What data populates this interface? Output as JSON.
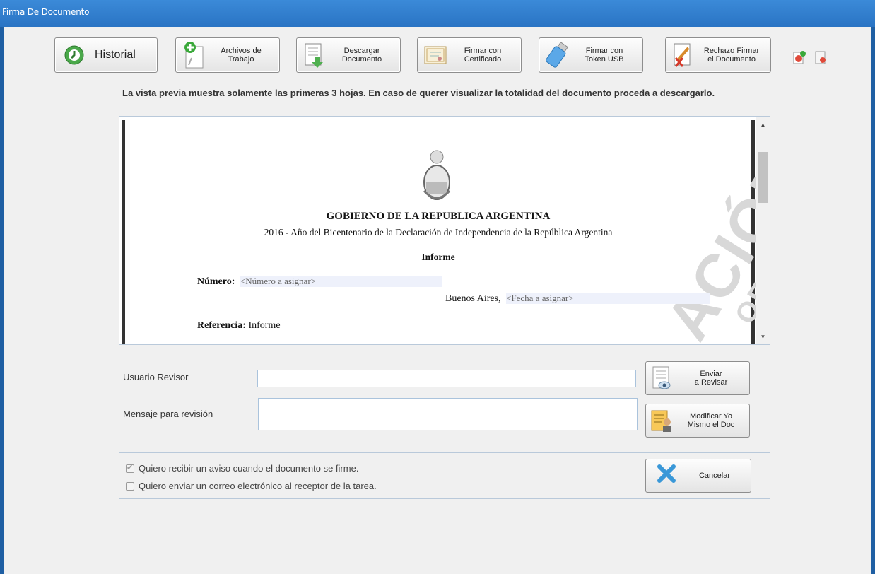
{
  "window": {
    "title": "Firma De Documento"
  },
  "toolbar": {
    "historial": "Historial",
    "archivos": "Archivos de\nTrabajo",
    "descargar": "Descargar\nDocumento",
    "firmar_cert": "Firmar con\nCertificado",
    "firmar_token": "Firmar con\nToken USB",
    "rechazo": "Rechazo Firmar\nel Documento"
  },
  "notice": "La vista previa muestra solamente las primeras 3 hojas. En caso de querer visualizar la totalidad del documento proceda a descargarlo.",
  "document": {
    "heading": "GOBIERNO DE LA REPUBLICA ARGENTINA",
    "year_line": "2016 - Año del Bicentenario de la Declaración de Independencia de la República Argentina",
    "type": "Informe",
    "numero_label": "Número:",
    "numero_value": "<Número a asignar>",
    "city": "Buenos Aires,",
    "fecha_value": "<Fecha a asignar>",
    "referencia_label": "Referencia:",
    "referencia_value": "Informe",
    "watermark_1": "ACIÓN",
    "watermark_2": "OFICIAL"
  },
  "review": {
    "usuario_label": "Usuario Revisor",
    "usuario_value": "",
    "mensaje_label": "Mensaje para revisión",
    "mensaje_value": "",
    "enviar_button": "Enviar\na Revisar",
    "modificar_button": "Modificar Yo\nMismo el Doc"
  },
  "options": {
    "aviso_label": "Quiero recibir un aviso cuando el documento se firme.",
    "aviso_checked": true,
    "correo_label": "Quiero enviar un correo electrónico al receptor de la tarea.",
    "correo_checked": false,
    "cancel_button": "Cancelar"
  }
}
